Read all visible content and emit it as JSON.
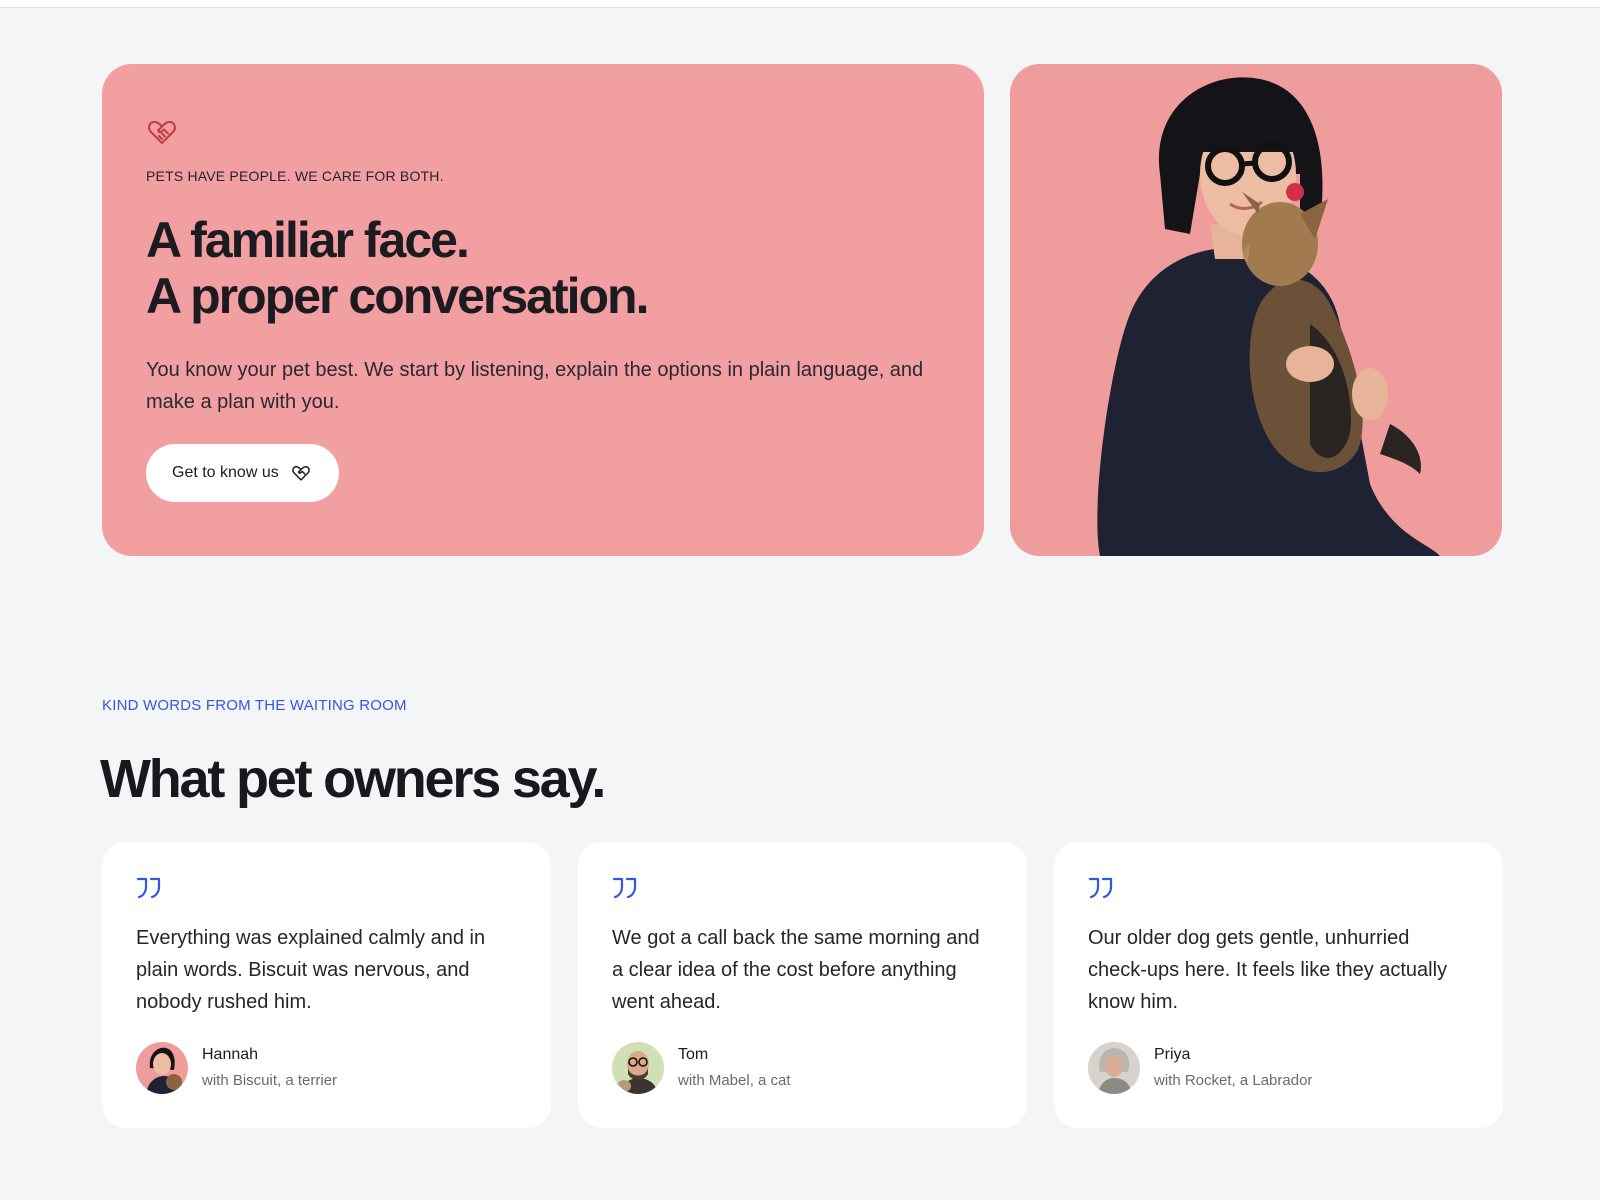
{
  "hero": {
    "eyebrow": "PETS HAVE PEOPLE. WE CARE FOR BOTH.",
    "headline_line1": "A familiar face.",
    "headline_line2": "A proper conversation.",
    "body": "You know your pet best. We start by listening, explain the options in plain language, and make a plan with you.",
    "cta_label": "Get to know us",
    "icon": "heart-handshake-icon",
    "card_color": "#f19fa1"
  },
  "photo": {
    "alt": "Woman with glasses holding a Yorkshire terrier",
    "background_color": "#ee9b9c"
  },
  "testimonials": {
    "eyebrow": "KIND WORDS FROM THE WAITING ROOM",
    "title": "What pet owners say.",
    "accent_color": "#3358e0",
    "items": [
      {
        "quote": "Everything was explained calmly and in plain words. Biscuit was nervous, and nobody rushed him.",
        "name": "Hannah",
        "pet": "with Biscuit, a terrier"
      },
      {
        "quote": "We got a call back the same morning and a clear idea of the cost before anything went ahead.",
        "name": "Tom",
        "pet": "with Mabel, a cat"
      },
      {
        "quote": "Our older dog gets gentle, unhurried check-ups here. It feels like they actually know him.",
        "name": "Priya",
        "pet": "with Rocket, a Labrador"
      }
    ]
  }
}
